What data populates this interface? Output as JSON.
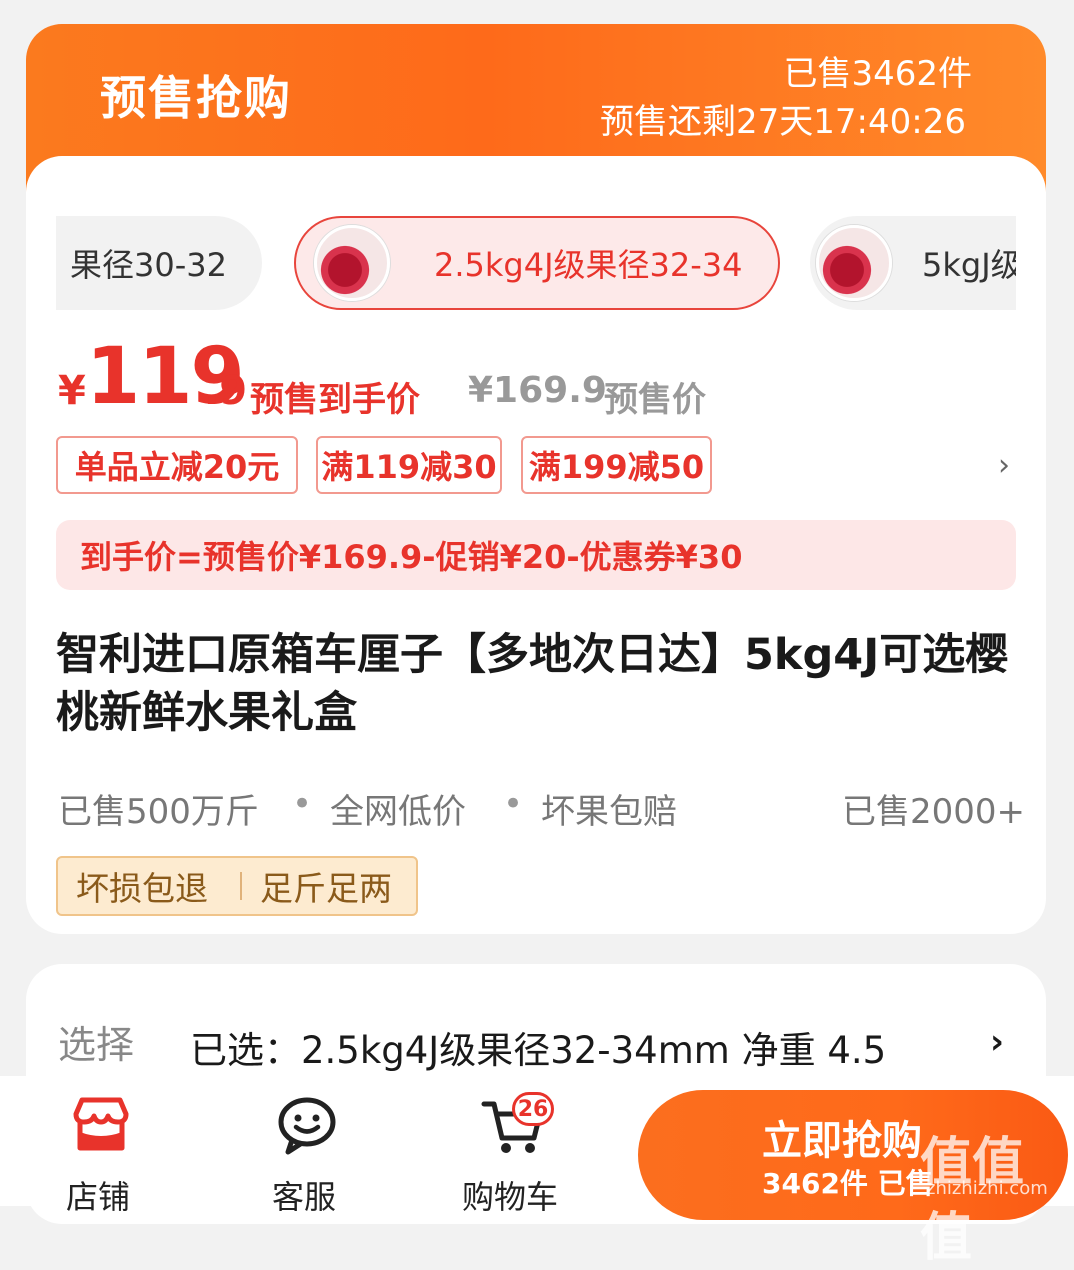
{
  "banner": {
    "title": "预售抢购",
    "sold": "已售3462件",
    "countdown": "预售还剩27天17:40:26"
  },
  "specs": [
    {
      "label": "果径30-32"
    },
    {
      "label": "2.5kg4J级果径32-34",
      "selected": true
    },
    {
      "label": "5kgJ级"
    }
  ],
  "price": {
    "currency": "¥",
    "integer": "119",
    "decimal": ".9",
    "label": "预售到手价",
    "original": "¥169.9",
    "original_label": "预售价"
  },
  "promos": [
    "单品立减20元",
    "满119减30",
    "满199减50"
  ],
  "formula": "到手价=预售价¥169.9-促销¥20-优惠券¥30",
  "title": "智利进口原箱车厘子【多地次日达】5kg4J可选樱桃新鲜水果礼盒",
  "tags": {
    "t1": "已售500万斤",
    "t2": "全网低价",
    "t3": "坏果包赔",
    "sold": "已售2000+"
  },
  "guarantees": [
    "坏损包退",
    "足斤足两"
  ],
  "selection": {
    "label": "选择",
    "value": "已选：2.5kg4J级果径32-34mm 净重 4.5"
  },
  "bottom_nav": {
    "shop": "店铺",
    "service": "客服",
    "cart": "购物车",
    "cart_count": "26"
  },
  "buy_button": {
    "label": "立即抢购",
    "sub": "3462件 已售"
  },
  "watermark": {
    "text": "值值值",
    "url": "zhizhizhi.com"
  },
  "colors": {
    "accent": "#e8332b",
    "banner": "#fe6a1a",
    "guarantee_bg": "#fdebd0"
  }
}
